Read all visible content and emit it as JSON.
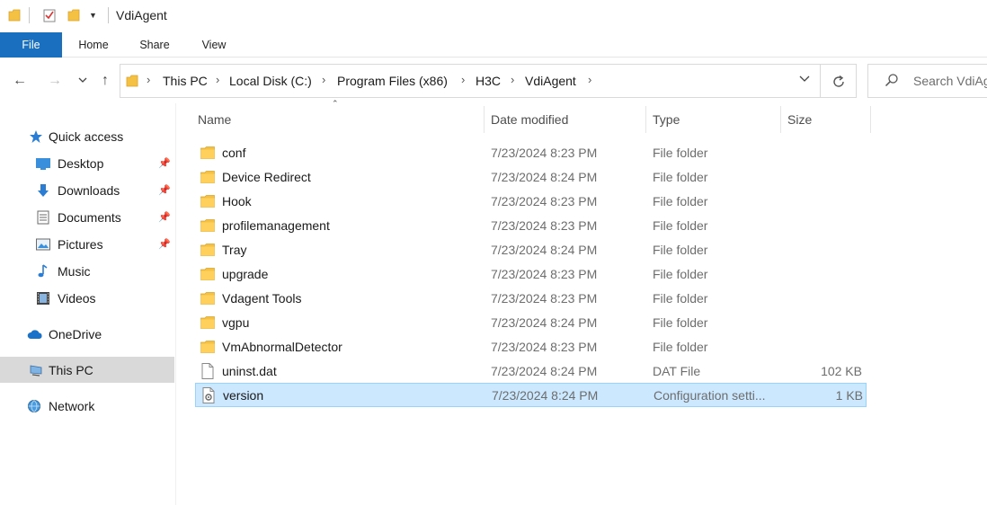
{
  "window": {
    "title": "VdiAgent"
  },
  "ribbon": {
    "tabs": [
      "File",
      "Home",
      "Share",
      "View"
    ]
  },
  "address": {
    "crumbs": [
      "This PC",
      "Local Disk (C:)",
      "Program Files (x86)",
      "H3C",
      "VdiAgent"
    ]
  },
  "search": {
    "placeholder": "Search VdiAgent"
  },
  "sidebar": {
    "quick_access": "Quick access",
    "items": [
      "Desktop",
      "Downloads",
      "Documents",
      "Pictures",
      "Music",
      "Videos"
    ],
    "onedrive": "OneDrive",
    "thispc": "This PC",
    "network": "Network"
  },
  "columns": {
    "name": "Name",
    "date": "Date modified",
    "type": "Type",
    "size": "Size"
  },
  "files": [
    {
      "name": "conf",
      "date": "7/23/2024 8:23 PM",
      "type": "File folder",
      "size": ""
    },
    {
      "name": "Device Redirect",
      "date": "7/23/2024 8:24 PM",
      "type": "File folder",
      "size": ""
    },
    {
      "name": "Hook",
      "date": "7/23/2024 8:23 PM",
      "type": "File folder",
      "size": ""
    },
    {
      "name": "profilemanagement",
      "date": "7/23/2024 8:23 PM",
      "type": "File folder",
      "size": ""
    },
    {
      "name": "Tray",
      "date": "7/23/2024 8:24 PM",
      "type": "File folder",
      "size": ""
    },
    {
      "name": "upgrade",
      "date": "7/23/2024 8:23 PM",
      "type": "File folder",
      "size": ""
    },
    {
      "name": "Vdagent Tools",
      "date": "7/23/2024 8:23 PM",
      "type": "File folder",
      "size": ""
    },
    {
      "name": "vgpu",
      "date": "7/23/2024 8:24 PM",
      "type": "File folder",
      "size": ""
    },
    {
      "name": "VmAbnormalDetector",
      "date": "7/23/2024 8:23 PM",
      "type": "File folder",
      "size": ""
    },
    {
      "name": "uninst.dat",
      "date": "7/23/2024 8:24 PM",
      "type": "DAT File",
      "size": "102 KB"
    },
    {
      "name": "version",
      "date": "7/23/2024 8:24 PM",
      "type": "Configuration setti...",
      "size": "1 KB"
    }
  ],
  "colors": {
    "file_tab": "#1a6fbf",
    "selection": "#cce8ff",
    "selection_border": "#99d1ff",
    "folder": "#f5c144"
  }
}
